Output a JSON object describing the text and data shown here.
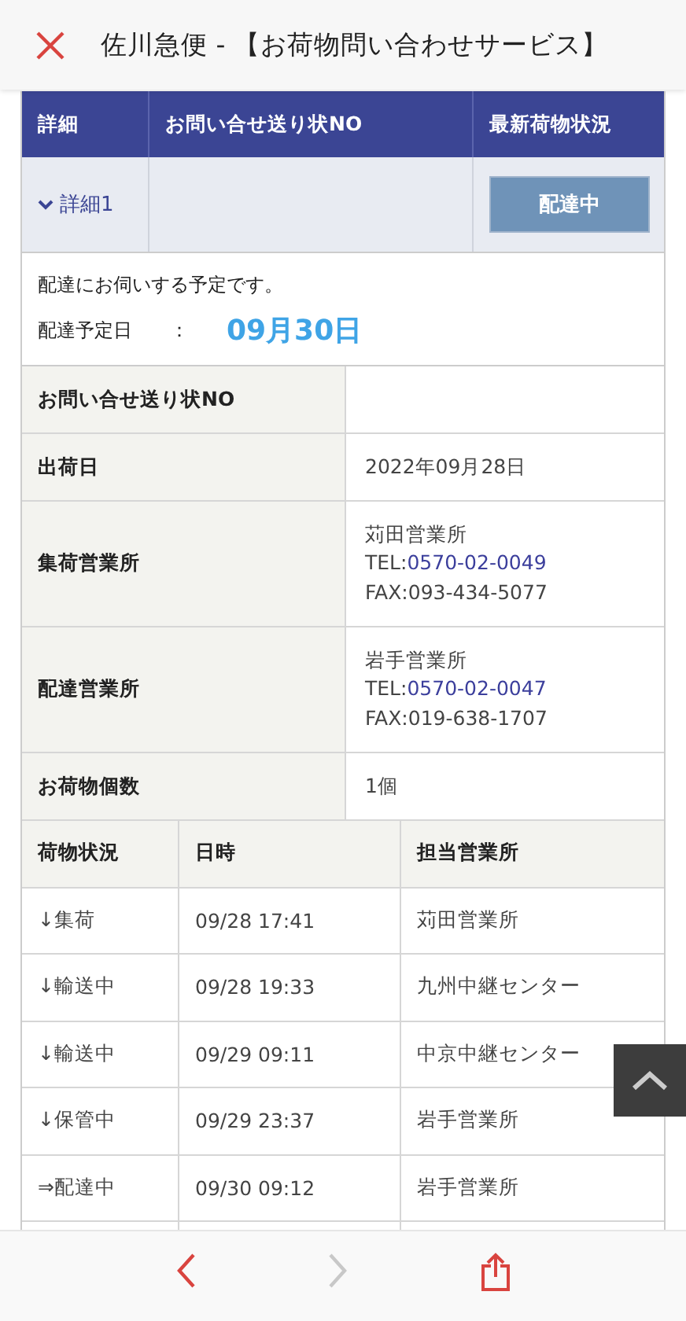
{
  "header": {
    "title": "佐川急便 - 【お荷物問い合わせサービス】"
  },
  "summary": {
    "columns": [
      "詳細",
      "お問い合せ送り状NO",
      "最新荷物状況"
    ],
    "row": {
      "detail_label": "詳細1",
      "expanded": true,
      "status": "配達中"
    }
  },
  "notice": {
    "message": "配達にお伺いする予定です。",
    "date_label": "配達予定日",
    "separator": "：",
    "date": "09月30日"
  },
  "info": [
    {
      "kind": "text",
      "label": "お問い合せ送り状NO"
    },
    {
      "kind": "text",
      "label": "出荷日",
      "value": "2022年09月28日"
    },
    {
      "kind": "office",
      "label": "集荷営業所",
      "name": "苅田営業所",
      "tel_label": "TEL:",
      "tel": "0570-02-0049",
      "fax": "FAX:093-434-5077"
    },
    {
      "kind": "office",
      "label": "配達営業所",
      "name": "岩手営業所",
      "tel_label": "TEL:",
      "tel": "0570-02-0047",
      "fax": "FAX:019-638-1707"
    },
    {
      "kind": "text",
      "label": "お荷物個数",
      "value": "1個"
    }
  ],
  "history": {
    "columns": [
      "荷物状況",
      "日時",
      "担当営業所"
    ],
    "rows": [
      [
        "↓集荷",
        "09/28 17:41",
        "苅田営業所"
      ],
      [
        "↓輸送中",
        "09/28 19:33",
        "九州中継センター"
      ],
      [
        "↓輸送中",
        "09/29 09:11",
        "中京中継センター"
      ],
      [
        "↓保管中",
        "09/29 23:37",
        "岩手営業所"
      ],
      [
        "⇒配達中",
        "09/30 09:12",
        "岩手営業所"
      ]
    ]
  },
  "toolbar": {
    "back_disabled": false,
    "forward_disabled": true
  }
}
